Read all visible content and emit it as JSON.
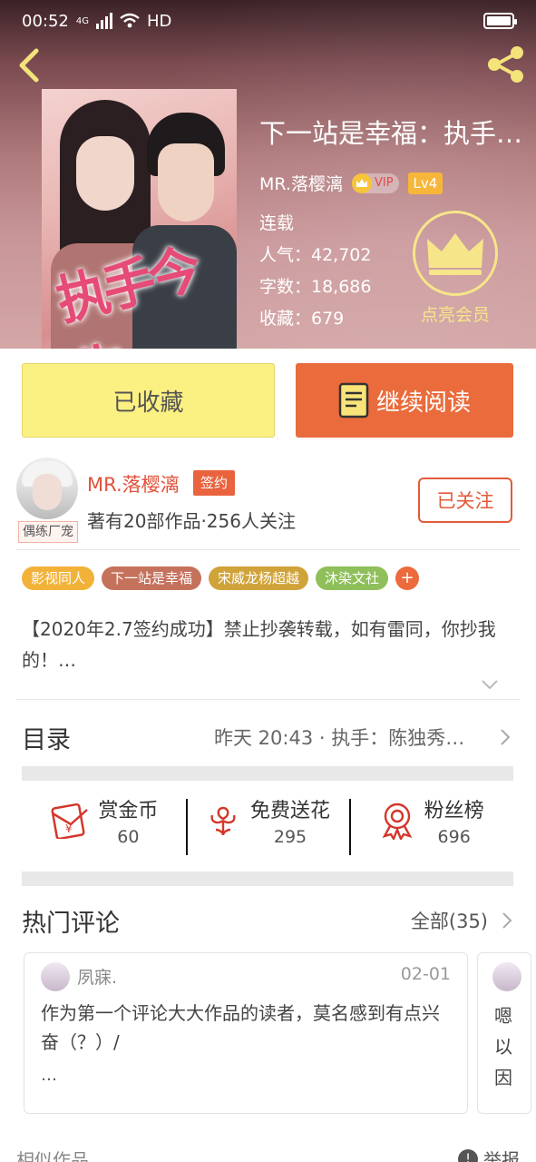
{
  "status_bar": {
    "time": "00:52",
    "network": "4G",
    "hd": "HD"
  },
  "book": {
    "title": "下一站是幸福：执手…",
    "author": "MR.落樱漓",
    "vip": "VIP",
    "level": "Lv4",
    "status": "连载",
    "popularity": "人气：42,702",
    "word_count": "字数：18,686",
    "favorites": "收藏：679",
    "cover_text": "执手今生"
  },
  "member": {
    "label": "点亮会员"
  },
  "buttons": {
    "collected": "已收藏",
    "continue_reading": "继续阅读"
  },
  "author_block": {
    "name": "MR.落樱漓",
    "sign_badge": "签约",
    "avatar_tag": "偶练厂宠",
    "summary": "著有20部作品·256人关注",
    "follow": "已关注"
  },
  "tags": [
    {
      "label": "影视同人",
      "color": "#f2b23a"
    },
    {
      "label": "下一站是幸福",
      "color": "#c5725d"
    },
    {
      "label": "宋威龙杨超越",
      "color": "#d0a33a"
    },
    {
      "label": "沐染文社",
      "color": "#8fbf5a"
    }
  ],
  "tag_add": {
    "label": "+",
    "color": "#ec6a3c"
  },
  "intro": "【2020年2.7签约成功】禁止抄袭转载，如有雷同，你抄我的！…",
  "toc": {
    "title": "目录",
    "latest": "昨天 20:43 · 执手：陈独秀…"
  },
  "actions": [
    {
      "name": "赏金币",
      "count": "60",
      "icon": "red-envelope-icon"
    },
    {
      "name": "免费送花",
      "count": "295",
      "icon": "flower-icon"
    },
    {
      "name": "粉丝榜",
      "count": "696",
      "icon": "medal-icon"
    }
  ],
  "hot_comments": {
    "title": "热门评论",
    "all": "全部(35)",
    "items": [
      {
        "user": "夙寐.",
        "date": "02-01",
        "text": "作为第一个评论大大作品的读者，莫名感到有点兴奋（？）/",
        "more": "…"
      }
    ],
    "peek_lines": [
      "嗯",
      "以",
      "因"
    ]
  },
  "footer": {
    "similar": "相似作品",
    "report": "举报"
  },
  "colors": {
    "accent": "#ea6b3b",
    "collected_bg": "#fbf082",
    "member_gold": "#f7e58a",
    "author_red": "#e0523a"
  }
}
